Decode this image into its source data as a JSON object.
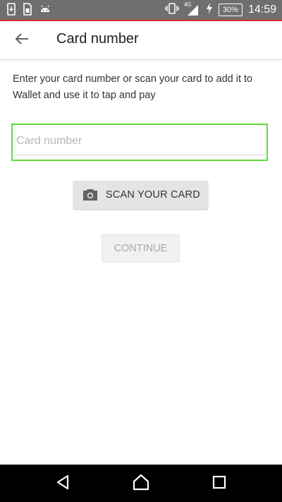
{
  "status_bar": {
    "left_icons": [
      "download-app-icon",
      "sim-icon",
      "android-icon"
    ],
    "right_icons": [
      "vibrate-icon",
      "signal-4g-icon",
      "charging-icon"
    ],
    "network_label": "4G",
    "battery_percent": "30%",
    "time": "14:59"
  },
  "app_bar": {
    "back_icon": "arrow-back-icon",
    "title": "Card number"
  },
  "main": {
    "instructions": "Enter your card number or scan your card to add it to Wallet and use it to tap and pay",
    "card_input": {
      "value": "",
      "placeholder": "Card number"
    },
    "scan_button": {
      "icon": "camera-icon",
      "label": "SCAN YOUR CARD"
    },
    "continue_button": {
      "label": "CONTINUE",
      "enabled": false
    }
  },
  "nav_bar": {
    "buttons": [
      "back-triangle-icon",
      "home-icon",
      "recents-square-icon"
    ]
  },
  "colors": {
    "status_bar_bg": "#6f6f6f",
    "status_bar_accent": "#d32f2f",
    "focus_outline": "#5fdc3e",
    "scan_button_bg": "#e4e4e4",
    "continue_disabled_text": "#a9a9a9",
    "nav_bar_bg": "#000000"
  }
}
